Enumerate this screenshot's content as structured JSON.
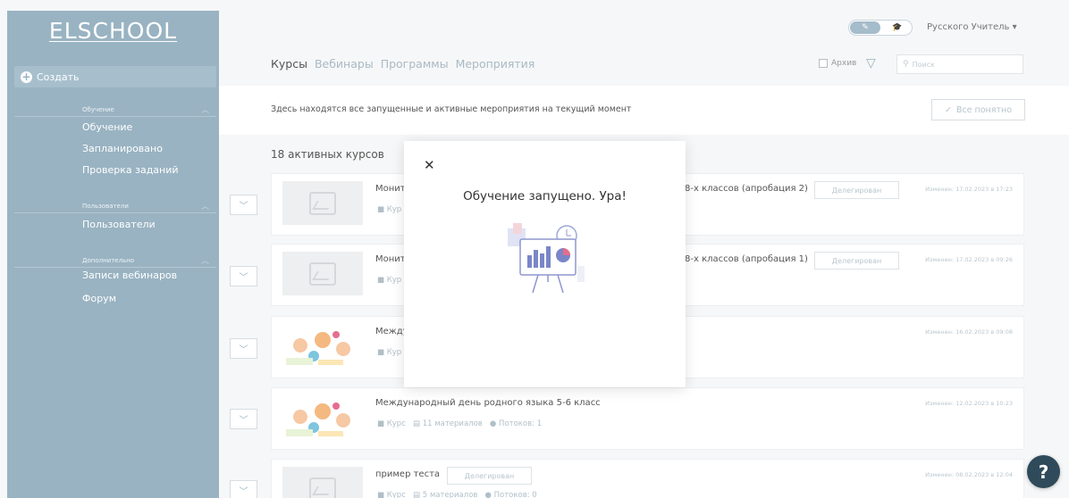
{
  "app": {
    "logo": "ELSCHOOL"
  },
  "sidebar": {
    "create_label": "Создать",
    "sections": [
      {
        "header": "Обучение",
        "items": [
          "Обучение",
          "Запланировано",
          "Проверка заданий"
        ]
      },
      {
        "header": "Пользователи",
        "items": [
          "Пользователи"
        ]
      },
      {
        "header": "Дополнительно",
        "items": [
          "Записи вебинаров",
          "Форум"
        ]
      }
    ]
  },
  "header": {
    "user_name": "Русского Учитель",
    "tabs": [
      {
        "label": "Курсы",
        "active": true
      },
      {
        "label": "Вебинары",
        "active": false
      },
      {
        "label": "Программы",
        "active": false
      },
      {
        "label": "Мероприятия",
        "active": false
      }
    ],
    "archive_label": "Архив",
    "search_placeholder": "Поиск"
  },
  "hint": {
    "text": "Здесь находятся все запущенные и активные мероприятия на текущий момент",
    "ok_label": "Все понятно"
  },
  "courses_count": "18 активных курсов",
  "courses": [
    {
      "title": "Монит",
      "title_tail": "8-х классов (апробация 2)",
      "meta": "Кур",
      "badge": "Делегирован",
      "changed": "Изменен: 17.02.2023 в 17:23"
    },
    {
      "title": "Монит",
      "title_tail": "8-х классов (апробация 1)",
      "meta": "Кур",
      "badge": "Делегирован",
      "changed": "Изменен: 17.02.2023 в 09:26"
    },
    {
      "title": "Между",
      "meta": "Кур",
      "changed": "Изменен: 16.02.2023 в 09:08"
    },
    {
      "title": "Международный день родного языка 5-6 класс",
      "meta_type": "Курс",
      "meta_materials": "11 материалов",
      "meta_streams": "Потоков: 1",
      "changed": "Изменен: 12.02.2023 в 10:23"
    },
    {
      "title": "пример теста",
      "badge": "Делегирован",
      "meta_type": "Курс",
      "meta_materials": "5 материалов",
      "meta_streams": "Потоков: 0",
      "changed": "Изменен: 08.02.2023 в 12:04"
    }
  ],
  "modal": {
    "title": "Обучение запущено. Ура!"
  },
  "icons": {
    "close": "close-icon",
    "help": "help-icon",
    "filter": "filter-icon",
    "search": "search-icon"
  }
}
